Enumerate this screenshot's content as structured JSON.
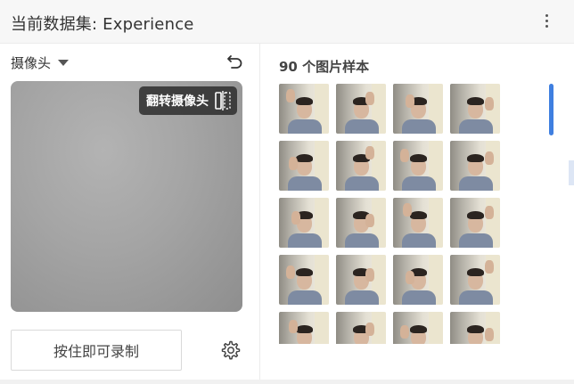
{
  "header": {
    "title": "当前数据集: Experience",
    "menu_icon": "more-vertical-icon"
  },
  "camera": {
    "select_label": "摄像头",
    "undo_icon": "undo-icon",
    "flip_label": "翻转摄像头",
    "flip_icon": "flip-camera-icon",
    "record_label": "按住即可录制",
    "settings_icon": "gear-icon"
  },
  "samples": {
    "title": "90 个图片样本",
    "visible_thumbnails": 20
  },
  "colors": {
    "accent": "#3f7fe0",
    "header_bg": "#f7f7f7",
    "video_bg": "#a4a4a4"
  }
}
